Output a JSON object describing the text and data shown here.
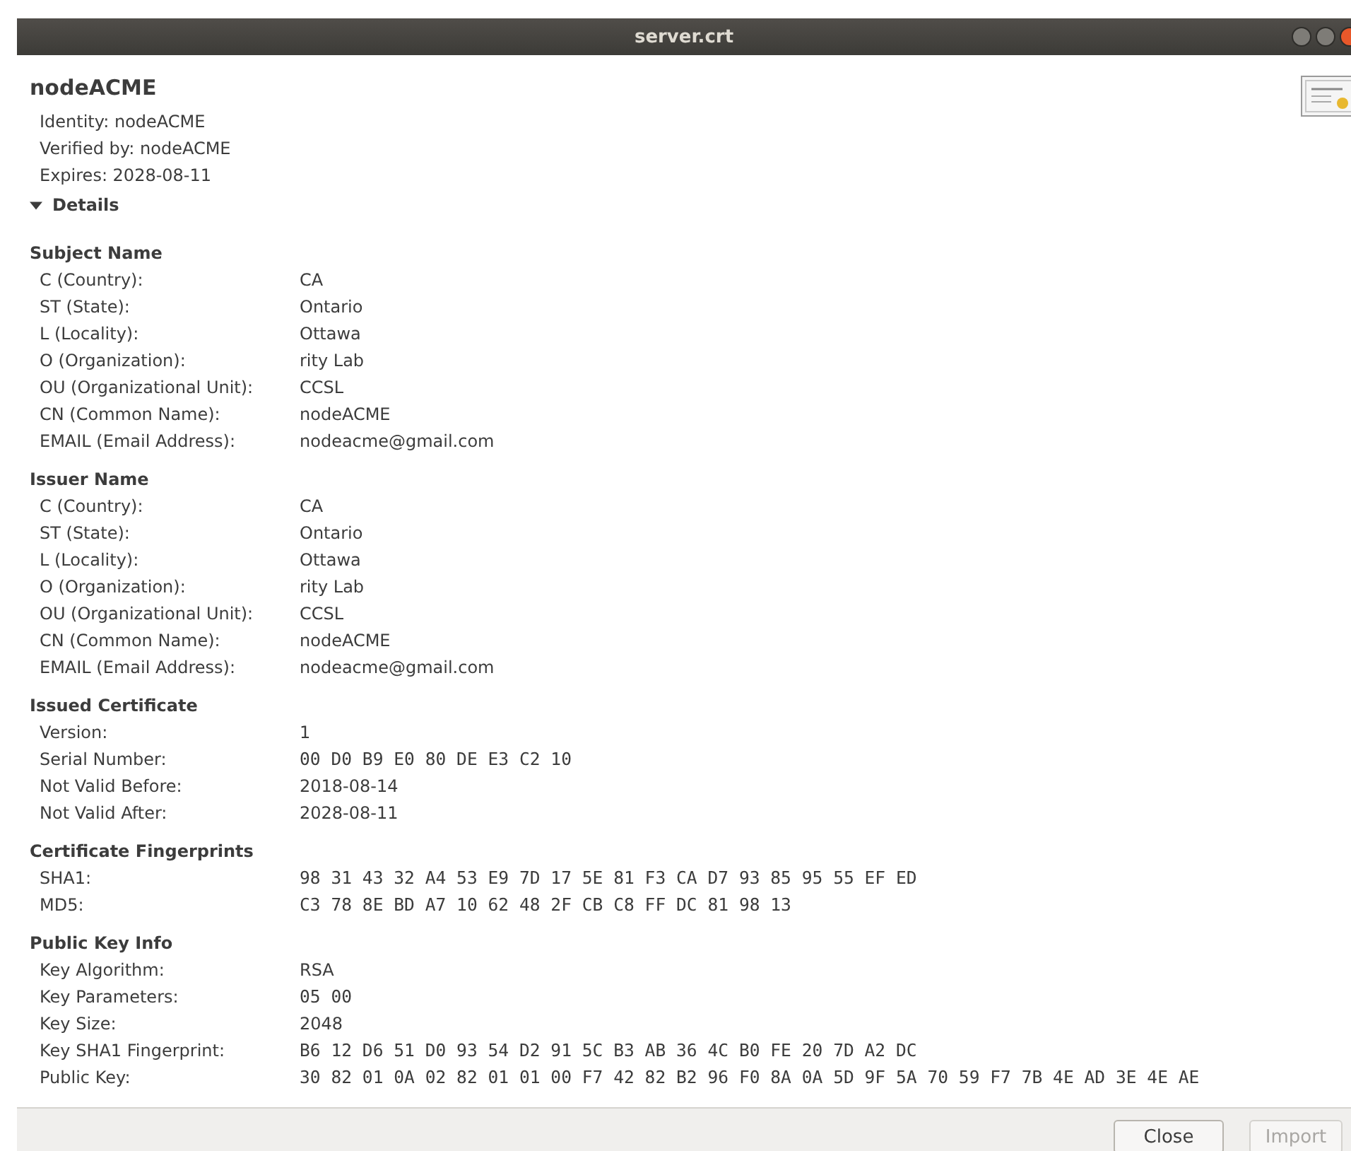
{
  "window": {
    "title": "server.crt"
  },
  "certificate": {
    "name": "nodeACME",
    "summary": [
      "Identity: nodeACME",
      "Verified by: nodeACME",
      "Expires: 2028-08-11"
    ]
  },
  "details": {
    "label": "Details",
    "expanded": true
  },
  "sections": [
    {
      "title": "Subject Name",
      "rows": [
        {
          "label": "C (Country):",
          "value": "CA",
          "kind": "text"
        },
        {
          "label": "ST (State):",
          "value": "Ontario",
          "kind": "text"
        },
        {
          "label": "L (Locality):",
          "value": "Ottawa",
          "kind": "text"
        },
        {
          "label": "O (Organization):",
          "value": "rity Lab",
          "kind": "text"
        },
        {
          "label": "OU (Organizational Unit):",
          "value": "CCSL",
          "kind": "text"
        },
        {
          "label": "CN (Common Name):",
          "value": "nodeACME",
          "kind": "text"
        },
        {
          "label": "EMAIL (Email Address):",
          "value": "nodeacme@gmail.com",
          "kind": "text"
        }
      ]
    },
    {
      "title": "Issuer Name",
      "rows": [
        {
          "label": "C (Country):",
          "value": "CA",
          "kind": "text"
        },
        {
          "label": "ST (State):",
          "value": "Ontario",
          "kind": "text"
        },
        {
          "label": "L (Locality):",
          "value": "Ottawa",
          "kind": "text"
        },
        {
          "label": "O (Organization):",
          "value": "rity Lab",
          "kind": "text"
        },
        {
          "label": "OU (Organizational Unit):",
          "value": "CCSL",
          "kind": "text"
        },
        {
          "label": "CN (Common Name):",
          "value": "nodeACME",
          "kind": "text"
        },
        {
          "label": "EMAIL (Email Address):",
          "value": "nodeacme@gmail.com",
          "kind": "text"
        }
      ]
    },
    {
      "title": "Issued Certificate",
      "rows": [
        {
          "label": "Version:",
          "value": "1",
          "kind": "text"
        },
        {
          "label": "Serial Number:",
          "value": "00 D0 B9 E0 80 DE E3 C2 10",
          "kind": "hex"
        },
        {
          "label": "Not Valid Before:",
          "value": "2018-08-14",
          "kind": "text"
        },
        {
          "label": "Not Valid After:",
          "value": "2028-08-11",
          "kind": "text"
        }
      ]
    },
    {
      "title": "Certificate Fingerprints",
      "rows": [
        {
          "label": "SHA1:",
          "value": "98 31 43 32 A4 53 E9 7D 17 5E 81 F3 CA D7 93 85 95 55 EF ED",
          "kind": "hex"
        },
        {
          "label": "MD5:",
          "value": "C3 78 8E BD A7 10 62 48 2F CB C8 FF DC 81 98 13",
          "kind": "hex"
        }
      ]
    },
    {
      "title": "Public Key Info",
      "rows": [
        {
          "label": "Key Algorithm:",
          "value": "RSA",
          "kind": "text"
        },
        {
          "label": "Key Parameters:",
          "value": "05 00",
          "kind": "hex"
        },
        {
          "label": "Key Size:",
          "value": "2048",
          "kind": "text"
        },
        {
          "label": "Key SHA1 Fingerprint:",
          "value": "B6 12 D6 51 D0 93 54 D2 91 5C B3 AB 36 4C B0 FE 20 7D A2 DC",
          "kind": "hex"
        },
        {
          "label": "Public Key:",
          "value": "30 82 01 0A 02 82 01 01 00 F7 42 82 B2 96 F0 8A 0A 5D 9F 5A 70 59 F7 7B 4E AD 3E 4E AE",
          "kind": "hex"
        }
      ]
    }
  ],
  "buttons": [
    {
      "label": "Close",
      "disabled": false
    },
    {
      "label": "Import",
      "disabled": true
    }
  ]
}
